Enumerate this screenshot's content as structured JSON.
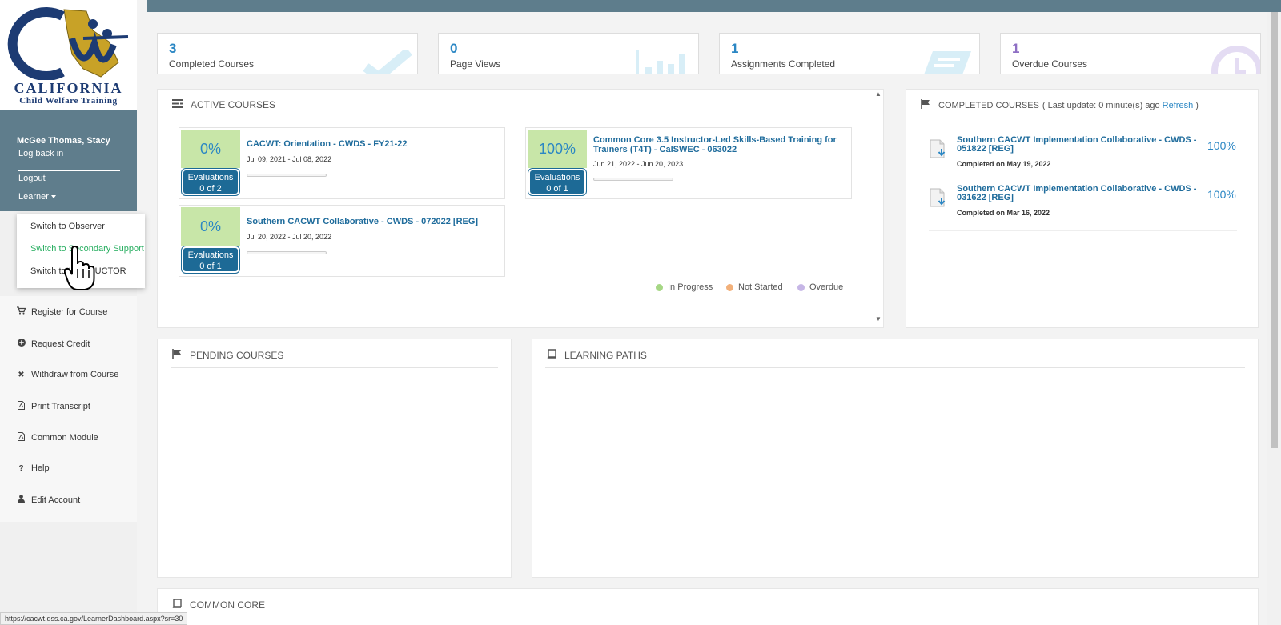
{
  "logo": {
    "title": "CALIFORNIA",
    "subtitle": "Child Welfare Training"
  },
  "user": {
    "name": "McGee Thomas, Stacy",
    "log_back_in": "Log back in",
    "logout": "Logout",
    "role": "Learner"
  },
  "role_menu": {
    "items": [
      "Switch to Observer",
      "Switch to Secondary Support",
      "Switch to INSTRUCTOR"
    ]
  },
  "nav": {
    "items": [
      {
        "label": "Register for Course",
        "icon": "cart-icon"
      },
      {
        "label": "Request Credit",
        "icon": "plus-circle-icon"
      },
      {
        "label": "Withdraw from Course",
        "icon": "times-icon"
      },
      {
        "label": "Print Transcript",
        "icon": "pdf-icon"
      },
      {
        "label": "Common Module",
        "icon": "pdf-icon"
      },
      {
        "label": "Help",
        "icon": "question-icon"
      },
      {
        "label": "Edit Account",
        "icon": "user-icon"
      }
    ]
  },
  "stats": [
    {
      "num": "3",
      "label": "Completed Courses",
      "color": "#2b87c4"
    },
    {
      "num": "0",
      "label": "Page Views",
      "color": "#2b87c4"
    },
    {
      "num": "1",
      "label": "Assignments Completed",
      "color": "#2b87c4"
    },
    {
      "num": "1",
      "label": "Overdue Courses",
      "color": "#8e6fc4"
    }
  ],
  "active_courses": {
    "heading": "ACTIVE COURSES",
    "courses": [
      {
        "pct": "0%",
        "title": "CACWT: Orientation - CWDS - FY21-22",
        "dates": "Jul 09, 2021 - Jul 08, 2022",
        "eval_label": "Evaluations",
        "eval_count": "0 of 2"
      },
      {
        "pct": "100%",
        "title": "Common Core 3.5 Instructor-Led Skills-Based Training for Trainers (T4T) - CalSWEC - 063022",
        "dates": "Jun 21, 2022 - Jun 20, 2023",
        "eval_label": "Evaluations",
        "eval_count": "0 of 1"
      },
      {
        "pct": "0%",
        "title": "Southern CACWT Collaborative - CWDS - 072022 [REG]",
        "dates": "Jul 20, 2022 - Jul 20, 2022",
        "eval_label": "Evaluations",
        "eval_count": "0 of 1"
      }
    ],
    "legend": [
      {
        "label": "In Progress",
        "color": "#a6d785"
      },
      {
        "label": "Not Started",
        "color": "#f2b07a"
      },
      {
        "label": "Overdue",
        "color": "#c6b6e6"
      }
    ]
  },
  "completed_courses": {
    "heading": "COMPLETED COURSES",
    "update_prefix": "( Last update: 0 minute(s) ago",
    "refresh": "Refresh",
    "update_suffix": ")",
    "items": [
      {
        "title": "Southern CACWT Implementation Collaborative - CWDS - 051822 [REG]",
        "date": "Completed on May 19, 2022",
        "pct": "100%"
      },
      {
        "title": "Southern CACWT Implementation Collaborative - CWDS - 031622 [REG]",
        "date": "Completed on Mar 16, 2022",
        "pct": "100%"
      }
    ]
  },
  "pending": {
    "heading": "PENDING COURSES"
  },
  "learning_paths": {
    "heading": "LEARNING PATHS"
  },
  "common_core": {
    "heading": "COMMON CORE"
  },
  "status_url": "https://cacwt.dss.ca.gov/LearnerDashboard.aspx?sr=30"
}
